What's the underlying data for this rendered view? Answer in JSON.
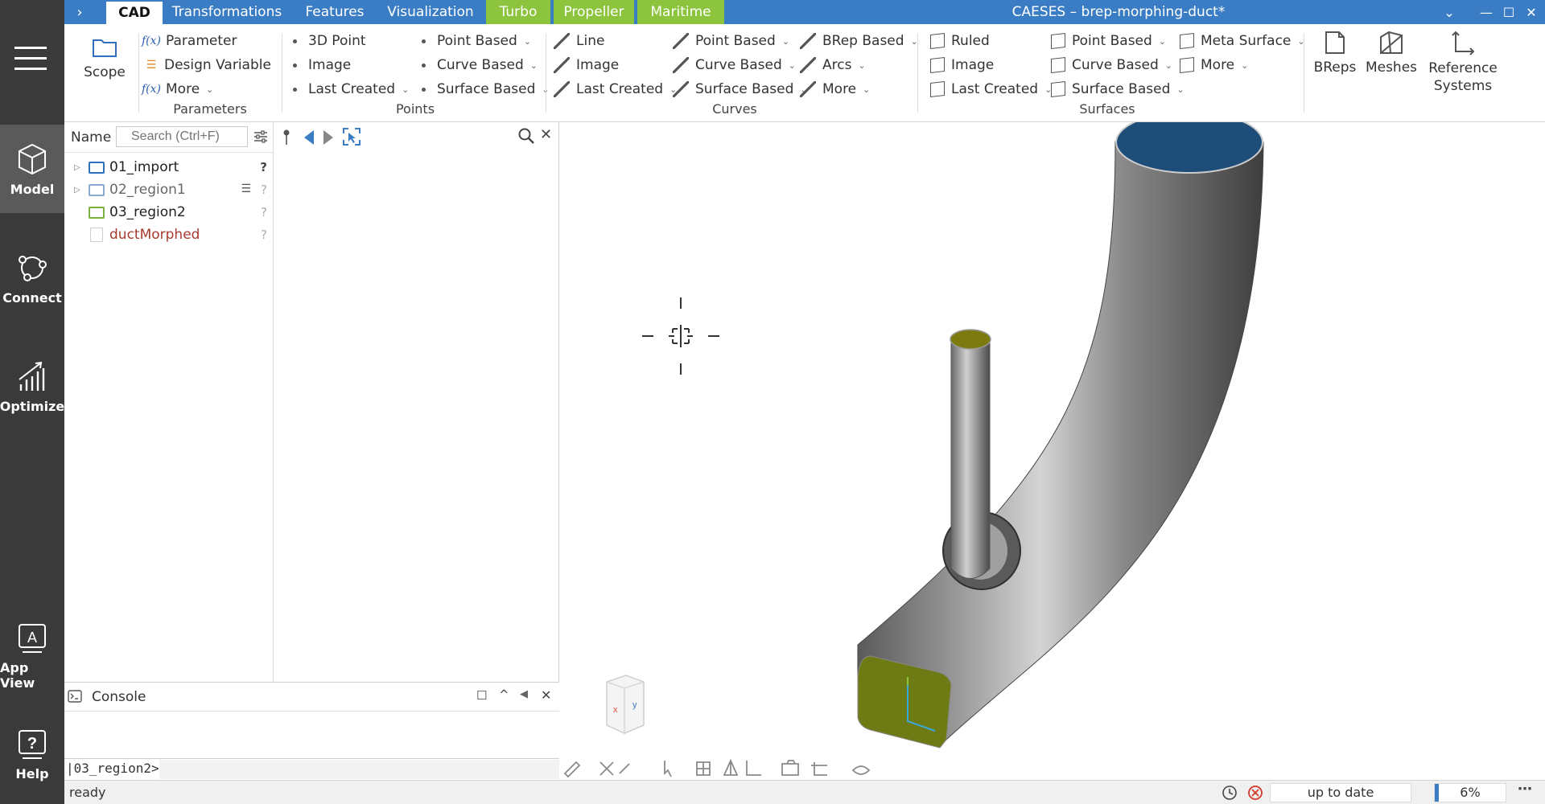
{
  "tabs": [
    {
      "label": "CAD",
      "active": true
    },
    {
      "label": "Transformations"
    },
    {
      "label": "Features"
    },
    {
      "label": "Visualization"
    },
    {
      "label": "Turbo",
      "accent": "#8cc43d"
    },
    {
      "label": "Propeller",
      "accent": "#8cc43d"
    },
    {
      "label": "Maritime",
      "accent": "#8cc43d"
    }
  ],
  "window": {
    "title": "CAESES  –  brep-morphing-duct*"
  },
  "appbar": {
    "model": "Model",
    "connect": "Connect",
    "optimize": "Optimize",
    "app_view": "App View",
    "help": "Help"
  },
  "ribbon": {
    "scope": "Scope",
    "parameters": {
      "label": "Parameters",
      "items": [
        "Parameter",
        "Design Variable",
        "More"
      ],
      "fx": "f(x)"
    },
    "points": {
      "label": "Points",
      "col1": [
        "3D Point",
        "Image",
        "Last Created"
      ],
      "col2": [
        "Point Based",
        "Curve Based",
        "Surface Based"
      ]
    },
    "curves": {
      "label": "Curves",
      "col1": [
        "Line",
        "Image",
        "Last Created"
      ],
      "col2": [
        "Point Based",
        "Curve Based",
        "Surface Based"
      ],
      "col3": [
        "BRep Based",
        "Arcs",
        "More"
      ]
    },
    "surfaces": {
      "label": "Surfaces",
      "col1": [
        "Ruled",
        "Image",
        "Last Created"
      ],
      "col2": [
        "Point Based",
        "Curve Based",
        "Surface Based"
      ],
      "col3": [
        "Meta Surface",
        "More"
      ]
    },
    "breps": "BReps",
    "meshes": "Meshes",
    "reference_systems": "Reference Systems"
  },
  "tree": {
    "column_name": "Name",
    "search_placeholder": "Search (Ctrl+F)",
    "items": [
      {
        "label": "01_import",
        "color": "#2f6fbf"
      },
      {
        "label": "02_region1",
        "color": "#8aa9cf"
      },
      {
        "label": "03_region2",
        "color": "#7ab23a"
      },
      {
        "label": "ductMorphed",
        "color": "#a83a2e"
      }
    ],
    "status_mark": "?"
  },
  "console": {
    "title": "Console",
    "prompt": "|03_region2>"
  },
  "status": {
    "left": "ready",
    "state": "up to date",
    "progress": "6%",
    "progress_fraction": 0.06
  },
  "colors": {
    "accent_blue": "#3b7dc4",
    "accent_green": "#8cc43d",
    "sidebar": "#3a3a3a"
  }
}
